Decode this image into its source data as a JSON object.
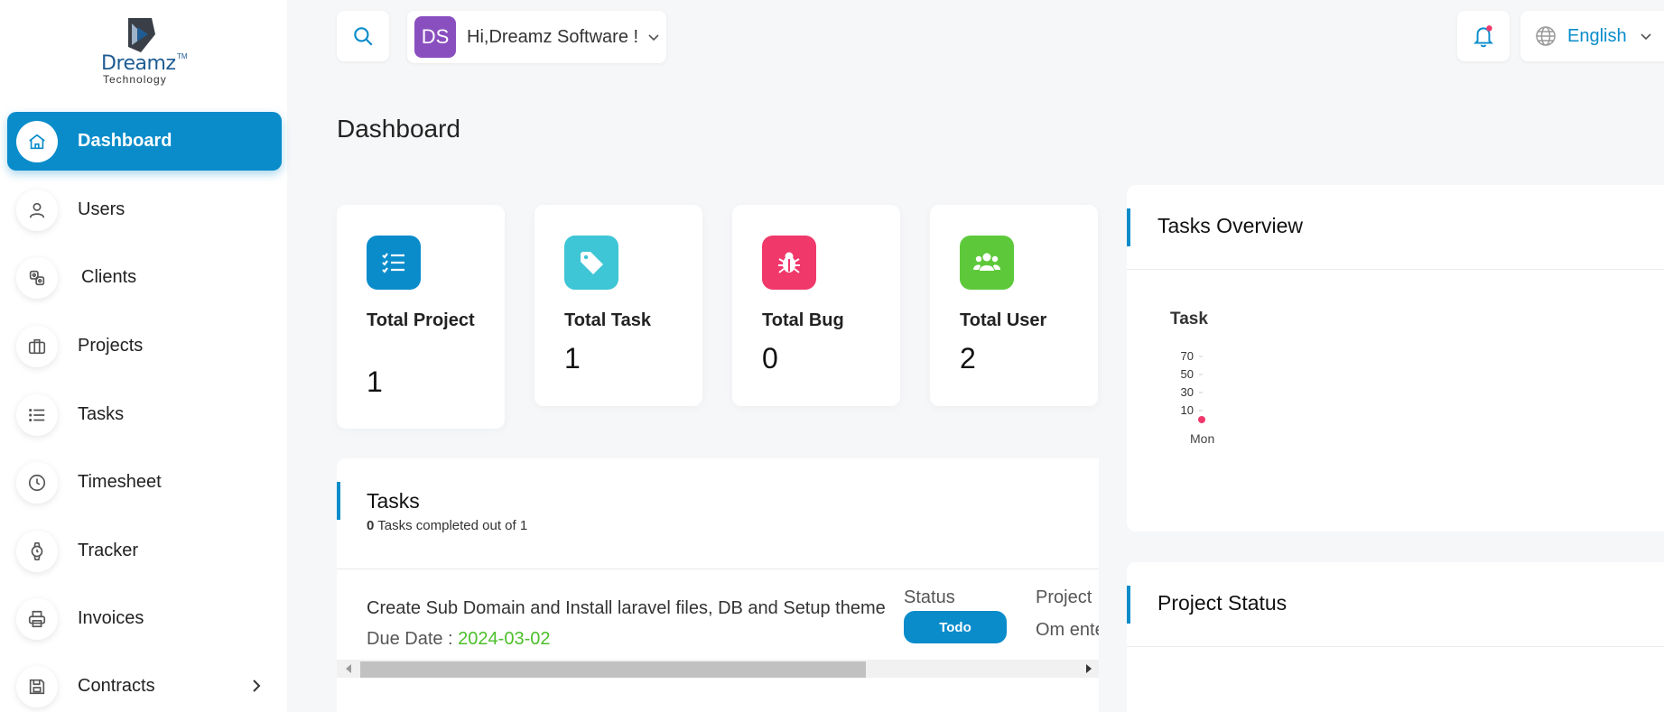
{
  "brand": {
    "name": "Dreamz",
    "tm": "TM",
    "tagline": "Technology"
  },
  "sidebar": {
    "items": [
      {
        "label": "Dashboard",
        "icon": "home-icon",
        "active": true
      },
      {
        "label": "Users",
        "icon": "user-icon"
      },
      {
        "label": "Clients",
        "icon": "clients-icon"
      },
      {
        "label": "Projects",
        "icon": "briefcase-icon"
      },
      {
        "label": "Tasks",
        "icon": "list-icon"
      },
      {
        "label": "Timesheet",
        "icon": "clock-icon"
      },
      {
        "label": "Tracker",
        "icon": "watch-icon"
      },
      {
        "label": "Invoices",
        "icon": "printer-icon"
      },
      {
        "label": "Contracts",
        "icon": "save-icon",
        "has_submenu": true
      }
    ]
  },
  "header": {
    "user_initials": "DS",
    "greeting": "Hi,Dreamz Software !",
    "language": "English"
  },
  "page": {
    "title": "Dashboard"
  },
  "stats": [
    {
      "label": "Total Project",
      "value": "1",
      "color": "#0a8ccb",
      "icon": "checklist-icon"
    },
    {
      "label": "Total Task",
      "value": "1",
      "color": "#3ec5d6",
      "icon": "tag-icon"
    },
    {
      "label": "Total Bug",
      "value": "0",
      "color": "#f0386b",
      "icon": "bug-icon"
    },
    {
      "label": "Total User",
      "value": "2",
      "color": "#5dc93a",
      "icon": "users-icon"
    }
  ],
  "tasks": {
    "title": "Tasks",
    "completed": "0",
    "summary": "Tasks completed out of 1",
    "rows": [
      {
        "name": "Create Sub Domain and Install laravel files, DB and Setup theme",
        "due_label": "Due Date :",
        "due_date": "2024-03-02",
        "status_header": "Status",
        "status": "Todo",
        "project_header": "Project",
        "project": "Om ente"
      }
    ]
  },
  "tasks_overview": {
    "title": "Tasks Overview",
    "chart_label": "Task",
    "x_label": "Mon",
    "y_ticks": [
      "70",
      "50",
      "30",
      "10"
    ]
  },
  "project_status": {
    "title": "Project Status"
  },
  "chart_data": {
    "type": "line",
    "title": "Task",
    "categories": [
      "Mon"
    ],
    "series": [
      {
        "values": [
          0
        ]
      }
    ],
    "ylim": [
      0,
      70
    ],
    "y_ticks": [
      10,
      30,
      50,
      70
    ]
  }
}
